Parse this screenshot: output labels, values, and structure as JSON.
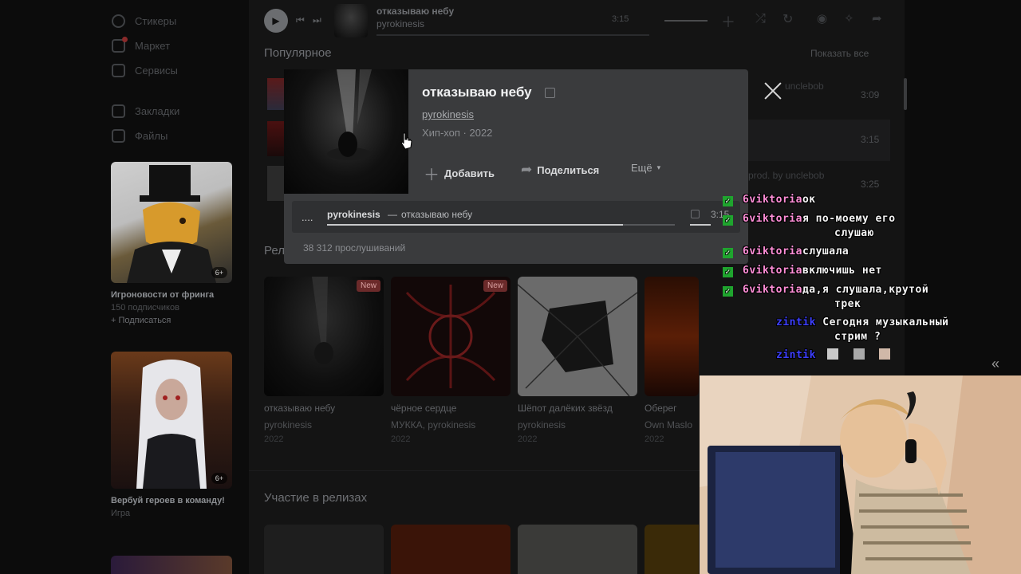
{
  "sidebar": {
    "items": [
      {
        "label": "Стикеры"
      },
      {
        "label": "Маркет"
      },
      {
        "label": "Сервисы"
      },
      {
        "label": "Закладки"
      },
      {
        "label": "Файлы"
      }
    ],
    "ads": [
      {
        "title": "Игроновости от фринга",
        "subtitle": "150 подписчиков",
        "action": "+ Подписаться",
        "age": "6+"
      },
      {
        "title": "Вербуй героев в команду!",
        "subtitle": "Игра",
        "age": "6+"
      }
    ]
  },
  "player": {
    "track_title": "отказываю небу",
    "artist": "pyrokinesis",
    "duration": "3:15"
  },
  "popular": {
    "title": "Популярное",
    "show_all": "Показать все",
    "rows": [
      {
        "meta": "3:09",
        "extra": "unclebob"
      },
      {
        "meta": "3:15",
        "extra": ""
      },
      {
        "meta": "3:25",
        "extra": "prod. by unclebob"
      }
    ]
  },
  "releases": {
    "title": "Релизы",
    "items": [
      {
        "title": "отказываю небу",
        "artist": "pyrokinesis",
        "year": "2022",
        "badge": "New"
      },
      {
        "title": "чёрное сердце",
        "artist": "МУККА, pyrokinesis",
        "year": "2022",
        "badge": "New"
      },
      {
        "title": "Шёпот далёких звёзд",
        "artist": "pyrokinesis",
        "year": "2022",
        "badge": ""
      },
      {
        "title": "Оберег",
        "artist": "Own Maslo",
        "year": "2022",
        "badge": ""
      }
    ]
  },
  "participation": {
    "title": "Участие в релизах"
  },
  "popup": {
    "title": "отказываю небу",
    "artist": "pyrokinesis",
    "genre_year": "Хип-хоп · 2022",
    "add_label": "Добавить",
    "share_label": "Поделиться",
    "more_label": "Ещё",
    "track_index": "....",
    "track_line_artist": "pyrokinesis",
    "track_line_sep": "—",
    "track_line_title": "отказываю небу",
    "track_duration": "3:15",
    "listens": "38 312 прослушиваний",
    "progress": 0.85
  },
  "chat": {
    "messages": [
      {
        "user": "6viktoria",
        "text": "ок"
      },
      {
        "user": "6viktoria",
        "text": "я по-моему его"
      },
      {
        "user": "",
        "text": "слушаю"
      },
      {
        "user": "6viktoria",
        "text": "слушала"
      },
      {
        "user": "6viktoria",
        "text": "включишь нет"
      },
      {
        "user": "6viktoria",
        "text": "да,я слушала,крутой"
      },
      {
        "user": "",
        "text": "трек"
      },
      {
        "user": "zintik",
        "text": "Сегодня музыкальный"
      },
      {
        "user": "",
        "text": "стрим ?"
      },
      {
        "user": "zintik",
        "text": ""
      }
    ],
    "collapse": "«"
  },
  "colors": {
    "chat_user_1": "#ff8fd8",
    "chat_user_2": "#3d3fff",
    "check": "#1fa52e"
  }
}
